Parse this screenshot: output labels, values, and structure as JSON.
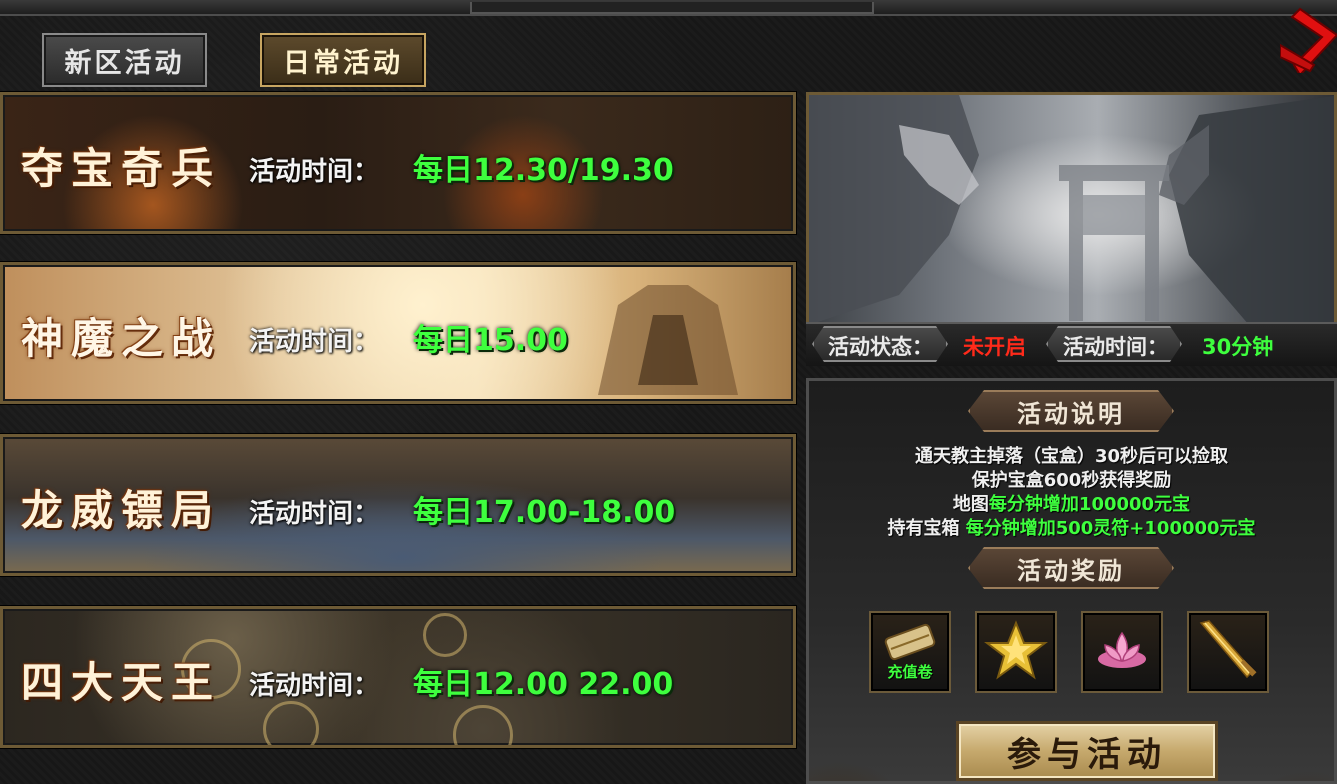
{
  "tabs": [
    {
      "label": "新区活动",
      "active": false
    },
    {
      "label": "日常活动",
      "active": true
    }
  ],
  "activities": [
    {
      "name": "夺宝奇兵",
      "time_label": "活动时间：",
      "time": "每日12.30/19.30"
    },
    {
      "name": "神魔之战",
      "time_label": "活动时间：",
      "time": "每日15.00"
    },
    {
      "name": "龙威镖局",
      "time_label": "活动时间：",
      "time": "每日17.00-18.00"
    },
    {
      "name": "四大天王",
      "time_label": "活动时间：",
      "time": "每日12.00 22.00"
    }
  ],
  "status": {
    "state_label": "活动状态：",
    "state_value": "未开启",
    "duration_label": "活动时间：",
    "duration_value": "30分钟"
  },
  "description": {
    "header": "活动说明",
    "line1": "通天教主掉落（宝盒）30秒后可以捡取",
    "line2": "保护宝盒600秒获得奖励",
    "line3_a": "地图",
    "line3_b": "每分钟增加100000元宝",
    "line4_a": "持有宝箱",
    "line4_b": "每分钟增加500灵符+100000元宝"
  },
  "rewards": {
    "header": "活动奖励",
    "items": [
      {
        "icon": "scroll-icon",
        "label": "充值卷"
      },
      {
        "icon": "gold-star-icon"
      },
      {
        "icon": "lotus-icon"
      },
      {
        "icon": "sword-icon"
      }
    ]
  },
  "join_button": "参与活动",
  "colors": {
    "highlight_green": "#3eff3e",
    "status_red": "#ff2a1a",
    "gold_border": "#6d5a35",
    "close_red": "#e01010"
  }
}
